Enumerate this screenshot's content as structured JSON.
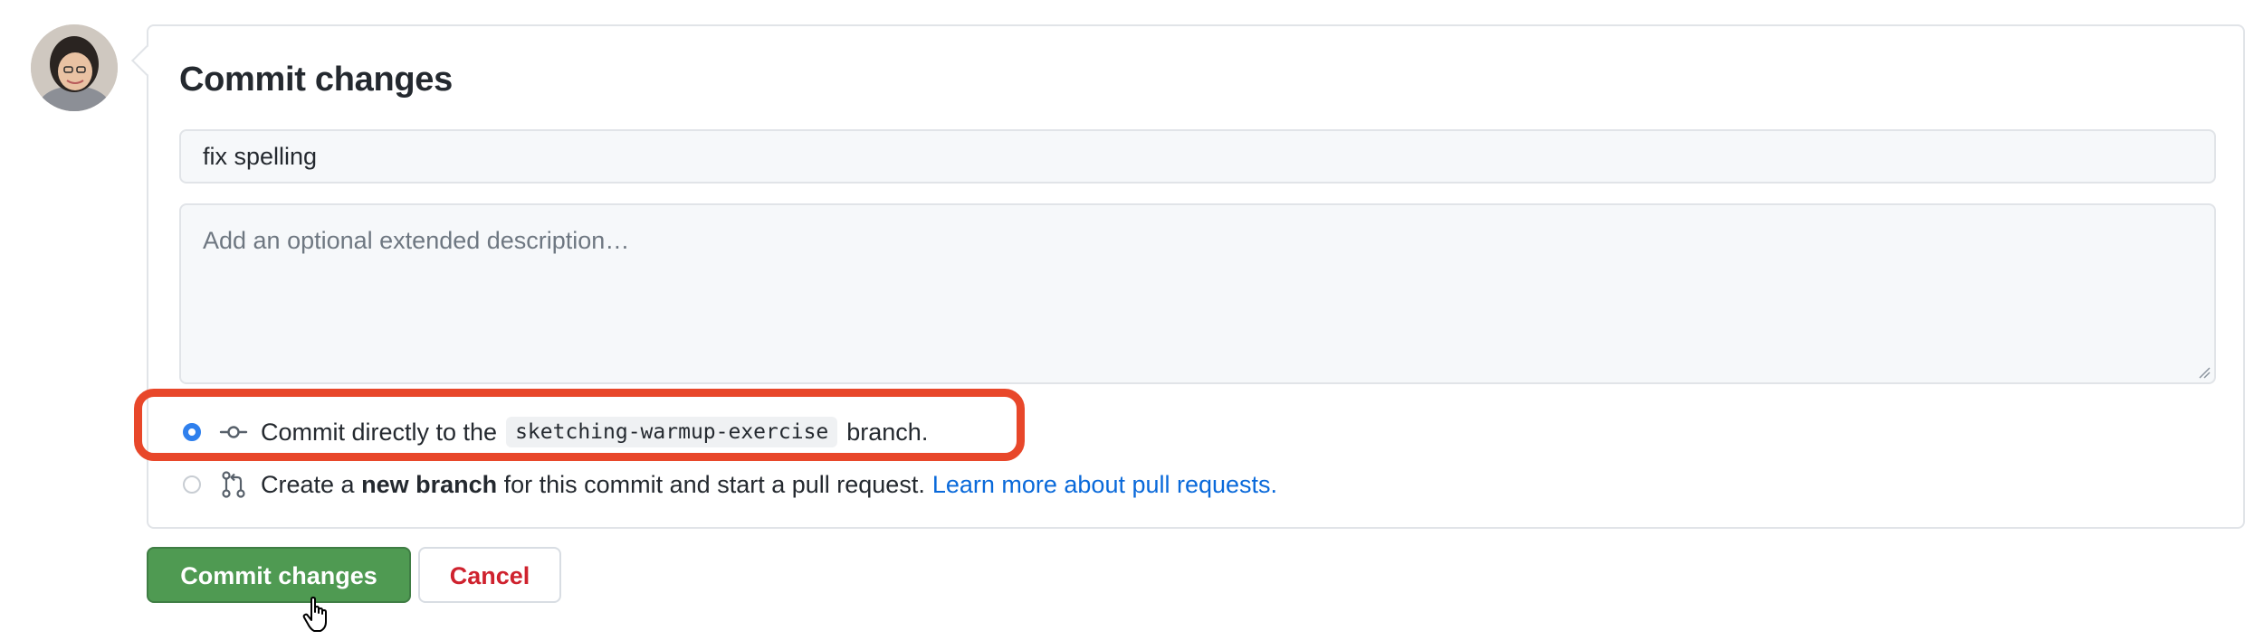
{
  "commit_form": {
    "title": "Commit changes",
    "summary_value": "fix spelling",
    "description_placeholder": "Add an optional extended description…",
    "options": [
      {
        "selected": true,
        "icon": "git-commit-icon",
        "text_before": "Commit directly to the",
        "branch_name": "sketching-warmup-exercise",
        "text_after": "branch."
      },
      {
        "selected": false,
        "icon": "git-pull-request-icon",
        "text_before": "Create a",
        "bold_text": "new branch",
        "text_after": "for this commit and start a pull request.",
        "link_text": "Learn more about pull requests."
      }
    ]
  },
  "buttons": {
    "commit_label": "Commit changes",
    "cancel_label": "Cancel"
  },
  "annotation": {
    "highlight_color": "#e8472a"
  },
  "colors": {
    "primary_button": "#4f9a52",
    "cancel_text": "#cf222e",
    "link": "#0969da",
    "radio_checked": "#2f80ed"
  }
}
